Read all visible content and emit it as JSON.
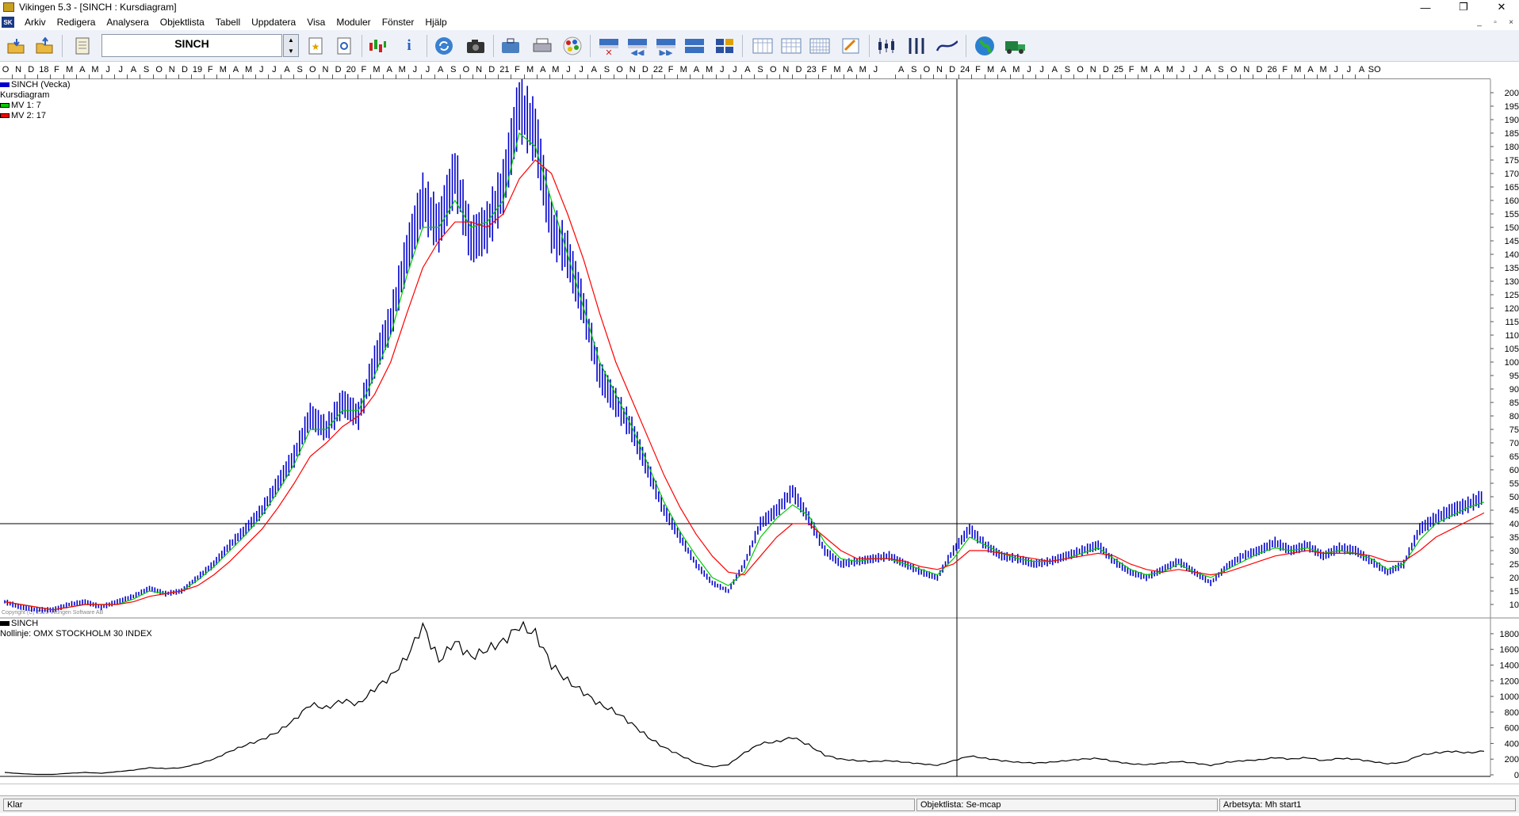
{
  "window": {
    "title": "Vikingen 5.3 - [SINCH : Kursdiagram]",
    "minimize": "—",
    "restore": "❐",
    "close": "✕"
  },
  "menu": {
    "items": [
      "Arkiv",
      "Redigera",
      "Analysera",
      "Objektlista",
      "Tabell",
      "Uppdatera",
      "Visa",
      "Moduler",
      "Fönster",
      "Hjälp"
    ],
    "mdi": {
      "minimize": "_",
      "restore": "▫",
      "close": "×"
    }
  },
  "toolbar": {
    "symbol": "SINCH",
    "spin_up": "▲",
    "spin_down": "▼",
    "icons": [
      "open-folder-icon",
      "export-folder-icon",
      "notebook-icon",
      "bookmark-star-icon",
      "search-doc-icon",
      "candles-color-icon",
      "info-icon",
      "refresh-icon",
      "camera-icon",
      "briefcase-icon",
      "print-icon",
      "palette-icon",
      "window-close-icon",
      "rewind-icon",
      "fast-forward-icon",
      "window-split-icon",
      "grid-numbers-icon",
      "calendar-day-icon",
      "calendar-week-icon",
      "calendar-month-icon",
      "edit-chart-icon",
      "candlestick-icon",
      "bars-icon",
      "line-chart-icon",
      "globe-icon",
      "truck-icon"
    ]
  },
  "timeline": {
    "labels": [
      "O",
      "N",
      "D",
      "18",
      "F",
      "M",
      "A",
      "M",
      "J",
      "J",
      "A",
      "S",
      "O",
      "N",
      "D",
      "19",
      "F",
      "M",
      "A",
      "M",
      "J",
      "J",
      "A",
      "S",
      "O",
      "N",
      "D",
      "20",
      "F",
      "M",
      "A",
      "M",
      "J",
      "J",
      "A",
      "S",
      "O",
      "N",
      "D",
      "21",
      "F",
      "M",
      "A",
      "M",
      "J",
      "J",
      "A",
      "S",
      "O",
      "N",
      "D",
      "22",
      "F",
      "M",
      "A",
      "M",
      "J",
      "J",
      "A",
      "S",
      "O",
      "N",
      "D",
      "23",
      "F",
      "M",
      "A",
      "M",
      "J",
      "",
      "A",
      "S",
      "O",
      "N",
      "D",
      "24",
      "F",
      "M",
      "A",
      "M",
      "J",
      "J",
      "A",
      "S",
      "O",
      "N",
      "D",
      "25",
      "F",
      "M",
      "A",
      "M",
      "J",
      "J",
      "A",
      "S",
      "O",
      "N",
      "D",
      "26",
      "F",
      "M",
      "A",
      "M",
      "J",
      "J",
      "A",
      "SO"
    ]
  },
  "legend_top": {
    "series": "SINCH (Vecka)",
    "type": "Kursdiagram",
    "ma1": "MV 1: 7",
    "ma2": "MV 2: 17"
  },
  "legend_bottom": {
    "series": "SINCH",
    "baseline": "Nollinje: OMX STOCKHOLM 30 INDEX"
  },
  "copyright": "Copyright (C) 2023 Vikingen Software AB",
  "colors": {
    "price": "#0000cc",
    "ma1": "#00cc00",
    "ma2": "#ff0000",
    "index": "#000000"
  },
  "status": {
    "left": "Klar",
    "objektlista": "Objektlista: Se-mcap",
    "arbetsyta": "Arbetsyta: Mh start1"
  },
  "chart_data": [
    {
      "type": "bar",
      "title": "SINCH (Vecka)",
      "ylim": [
        5,
        205
      ],
      "yticks": [
        10,
        15,
        20,
        25,
        30,
        35,
        40,
        45,
        50,
        55,
        60,
        65,
        70,
        75,
        80,
        85,
        90,
        95,
        100,
        105,
        110,
        115,
        120,
        125,
        130,
        135,
        140,
        145,
        150,
        155,
        160,
        165,
        170,
        175,
        180,
        185,
        190,
        195,
        200
      ],
      "horizontal_line": 40,
      "x": [
        "2017-10",
        "2017-12",
        "2018-03",
        "2018-06",
        "2018-09",
        "2018-12",
        "2019-03",
        "2019-06",
        "2019-08",
        "2019-10",
        "2019-12",
        "2020-01",
        "2020-02",
        "2020-03",
        "2020-04",
        "2020-05",
        "2020-06",
        "2020-07",
        "2020-08",
        "2020-09",
        "2020-10",
        "2020-11",
        "2020-12",
        "2021-01",
        "2021-02",
        "2021-03",
        "2021-04",
        "2021-05",
        "2021-06",
        "2021-07",
        "2021-08",
        "2021-09",
        "2021-10",
        "2021-11",
        "2021-12",
        "2022-01",
        "2022-02",
        "2022-03",
        "2022-04",
        "2022-05",
        "2022-06",
        "2022-07",
        "2022-08",
        "2022-09",
        "2022-10",
        "2022-11",
        "2022-12",
        "2023-01",
        "2023-02",
        "2023-03",
        "2023-04",
        "2023-05",
        "2023-06",
        "2023-07",
        "2023-08",
        "2023-09",
        "2023-10",
        "2023-11",
        "2023-12",
        "2024-01",
        "2024-02",
        "2024-03",
        "2024-04",
        "2024-05",
        "2024-06",
        "2024-07",
        "2024-08",
        "2024-09",
        "2024-10",
        "2024-11",
        "2024-12",
        "2025-01",
        "2025-02",
        "2025-03",
        "2025-04",
        "2025-05",
        "2025-06",
        "2025-07",
        "2025-08",
        "2025-09",
        "2025-10",
        "2025-11",
        "2025-12",
        "2026-01",
        "2026-02",
        "2026-03",
        "2026-04",
        "2026-05",
        "2026-06",
        "2026-07",
        "2026-08",
        "2026-09",
        "2026-10"
      ],
      "series": [
        {
          "name": "SINCH (Vecka)",
          "values": [
            11,
            9,
            8,
            8,
            10,
            11,
            9,
            11,
            13,
            16,
            14,
            15,
            20,
            25,
            32,
            38,
            45,
            55,
            65,
            80,
            75,
            85,
            80,
            100,
            115,
            140,
            160,
            150,
            170,
            145,
            150,
            165,
            195,
            185,
            150,
            140,
            120,
            95,
            85,
            75,
            60,
            45,
            35,
            25,
            18,
            15,
            25,
            40,
            45,
            52,
            42,
            30,
            25,
            26,
            27,
            28,
            25,
            22,
            20,
            30,
            38,
            32,
            28,
            27,
            25,
            26,
            28,
            30,
            32,
            26,
            22,
            20,
            23,
            26,
            22,
            18,
            24,
            28,
            30,
            33,
            30,
            32,
            28,
            31,
            30,
            26,
            22,
            25,
            38,
            42,
            45,
            47,
            50
          ]
        },
        {
          "name": "MV 1: 7",
          "values": [
            11,
            10,
            9,
            8,
            9,
            10,
            10,
            10,
            12,
            15,
            14,
            15,
            19,
            24,
            30,
            36,
            43,
            52,
            62,
            75,
            75,
            82,
            82,
            95,
            110,
            132,
            150,
            150,
            160,
            150,
            152,
            160,
            185,
            180,
            160,
            140,
            120,
            100,
            88,
            76,
            62,
            48,
            37,
            28,
            20,
            17,
            22,
            35,
            42,
            47,
            43,
            33,
            27,
            26,
            27,
            27,
            25,
            23,
            21,
            27,
            35,
            32,
            29,
            27,
            26,
            26,
            27,
            29,
            31,
            27,
            23,
            21,
            22,
            25,
            22,
            20,
            23,
            26,
            29,
            31,
            30,
            31,
            29,
            30,
            29,
            27,
            23,
            25,
            34,
            40,
            43,
            46,
            48
          ]
        },
        {
          "name": "MV 2: 17",
          "values": [
            11,
            10,
            9,
            8,
            9,
            10,
            10,
            10,
            11,
            13,
            14,
            15,
            17,
            21,
            26,
            32,
            38,
            46,
            55,
            65,
            70,
            76,
            80,
            88,
            100,
            118,
            135,
            145,
            152,
            152,
            150,
            155,
            168,
            175,
            170,
            155,
            138,
            118,
            100,
            86,
            72,
            58,
            46,
            36,
            28,
            22,
            21,
            28,
            35,
            40,
            40,
            35,
            30,
            27,
            27,
            27,
            26,
            24,
            23,
            25,
            30,
            30,
            29,
            28,
            27,
            26,
            27,
            28,
            29,
            28,
            25,
            23,
            22,
            23,
            22,
            21,
            22,
            24,
            26,
            28,
            29,
            30,
            29,
            29,
            29,
            28,
            26,
            26,
            30,
            35,
            38,
            41,
            44
          ]
        }
      ]
    },
    {
      "type": "line",
      "title": "SINCH",
      "ylim": [
        0,
        1900
      ],
      "yticks": [
        0,
        200,
        400,
        600,
        800,
        1000,
        1200,
        1400,
        1600,
        1800
      ],
      "series": [
        {
          "name": "SINCH",
          "values": [
            30,
            15,
            5,
            5,
            20,
            30,
            20,
            40,
            60,
            90,
            80,
            90,
            140,
            200,
            300,
            380,
            450,
            550,
            700,
            900,
            850,
            950,
            900,
            1100,
            1250,
            1500,
            1900,
            1450,
            1700,
            1500,
            1600,
            1700,
            1900,
            1800,
            1400,
            1200,
            1050,
            900,
            800,
            650,
            480,
            350,
            250,
            150,
            100,
            130,
            280,
            400,
            420,
            480,
            380,
            250,
            200,
            180,
            170,
            180,
            160,
            140,
            120,
            180,
            240,
            210,
            180,
            160,
            150,
            160,
            180,
            200,
            210,
            170,
            140,
            130,
            150,
            170,
            150,
            120,
            160,
            180,
            190,
            220,
            200,
            220,
            180,
            210,
            200,
            170,
            140,
            160,
            250,
            280,
            300,
            280,
            300
          ]
        }
      ]
    }
  ]
}
